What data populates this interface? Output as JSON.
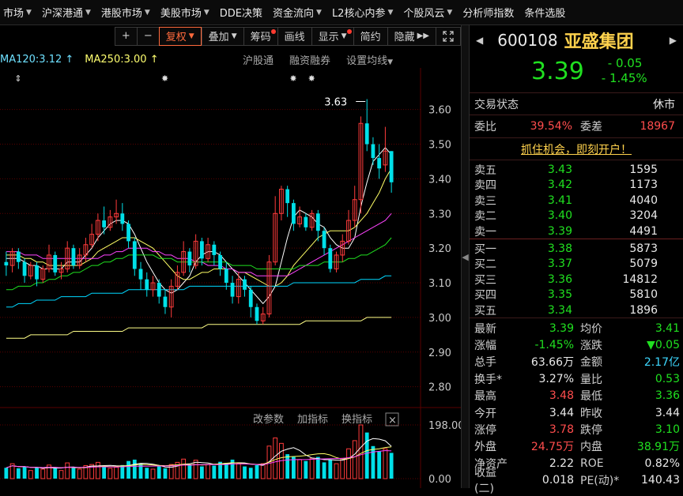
{
  "menu": [
    "市场",
    "沪深港通",
    "港股市场",
    "美股市场",
    "DDE决策",
    "资金流向",
    "L2核心内参",
    "个股风云",
    "分析师指数",
    "条件选股"
  ],
  "menu_arrows": [
    true,
    true,
    true,
    true,
    false,
    true,
    true,
    true,
    false,
    false
  ],
  "toolbar": {
    "plus": "+",
    "minus": "−",
    "fuquan": "复权",
    "diejia": "叠加",
    "chouma": "筹码",
    "huaxian": "画线",
    "xianshi": "显示",
    "jianyue": "简约",
    "yincang": "隐藏",
    "expand_icon": "double-chevron-right",
    "fullscreen_icon": "expand-arrows"
  },
  "ma_legend": {
    "ma120": "MA120:3.12",
    "ma250": "MA250:3.00",
    "arrow": "↑"
  },
  "chart_links": {
    "hugutong": "沪股通",
    "rongzi": "融资融券",
    "shezhi": "设置均线"
  },
  "indicator_links": {
    "gaicanshu": "改参数",
    "jiazhibiao": "加指标",
    "huanzhibiao": "换指标",
    "close": "×"
  },
  "colors": {
    "up": "#ff3b3b",
    "down": "#00e0e8",
    "ma5": "#ffffff",
    "ma10": "#ffff66",
    "ma20": "#ff44ff",
    "ma60": "#20e020",
    "ma120": "#00d8ff",
    "ma250": "#ffff88",
    "grid": "#5a0000"
  },
  "chart_data": {
    "type": "candlestick",
    "y_ticks": [
      "3.60",
      "3.50",
      "3.40",
      "3.30",
      "3.20",
      "3.10",
      "3.00",
      "2.90",
      "2.80"
    ],
    "ylim": [
      2.74,
      3.72
    ],
    "high_label": "3.63",
    "volume_ticks": [
      "198.00",
      "0.00"
    ],
    "volume_max": 198,
    "candles": [
      [
        3.16,
        3.15,
        3.19,
        3.12
      ],
      [
        3.15,
        3.19,
        3.2,
        3.13
      ],
      [
        3.19,
        3.16,
        3.2,
        3.14
      ],
      [
        3.16,
        3.12,
        3.17,
        3.1
      ],
      [
        3.12,
        3.15,
        3.16,
        3.11
      ],
      [
        3.15,
        3.11,
        3.16,
        3.09
      ],
      [
        3.11,
        3.14,
        3.15,
        3.1
      ],
      [
        3.14,
        3.18,
        3.21,
        3.13
      ],
      [
        3.18,
        3.13,
        3.19,
        3.12
      ],
      [
        3.13,
        3.14,
        3.16,
        3.11
      ],
      [
        3.14,
        3.2,
        3.22,
        3.13
      ],
      [
        3.2,
        3.15,
        3.21,
        3.14
      ],
      [
        3.15,
        3.18,
        3.2,
        3.14
      ],
      [
        3.18,
        3.21,
        3.23,
        3.16
      ],
      [
        3.21,
        3.24,
        3.27,
        3.2
      ],
      [
        3.24,
        3.28,
        3.3,
        3.22
      ],
      [
        3.28,
        3.26,
        3.32,
        3.24
      ],
      [
        3.26,
        3.29,
        3.31,
        3.25
      ],
      [
        3.29,
        3.3,
        3.34,
        3.27
      ],
      [
        3.3,
        3.27,
        3.33,
        3.25
      ],
      [
        3.27,
        3.22,
        3.28,
        3.2
      ],
      [
        3.22,
        3.14,
        3.23,
        3.12
      ],
      [
        3.14,
        3.11,
        3.16,
        3.08
      ],
      [
        3.11,
        3.08,
        3.13,
        3.06
      ],
      [
        3.08,
        3.1,
        3.12,
        3.06
      ],
      [
        3.1,
        3.06,
        3.11,
        3.04
      ],
      [
        3.06,
        3.03,
        3.08,
        3.01
      ],
      [
        3.03,
        3.09,
        3.11,
        3.0
      ],
      [
        3.09,
        3.13,
        3.15,
        3.08
      ],
      [
        3.13,
        3.19,
        3.22,
        3.12
      ],
      [
        3.19,
        3.15,
        3.2,
        3.13
      ],
      [
        3.15,
        3.22,
        3.24,
        3.14
      ],
      [
        3.22,
        3.17,
        3.23,
        3.15
      ],
      [
        3.17,
        3.21,
        3.23,
        3.16
      ],
      [
        3.21,
        3.18,
        3.22,
        3.15
      ],
      [
        3.18,
        3.14,
        3.19,
        3.12
      ],
      [
        3.14,
        3.1,
        3.16,
        3.08
      ],
      [
        3.1,
        3.06,
        3.12,
        3.04
      ],
      [
        3.06,
        3.11,
        3.13,
        3.04
      ],
      [
        3.11,
        3.08,
        3.12,
        3.06
      ],
      [
        3.08,
        3.03,
        3.09,
        3.0
      ],
      [
        3.03,
        2.99,
        3.04,
        2.98
      ],
      [
        2.99,
        3.01,
        3.03,
        2.98
      ],
      [
        3.01,
        3.16,
        3.18,
        3.0
      ],
      [
        3.16,
        3.3,
        3.35,
        3.15
      ],
      [
        3.3,
        3.37,
        3.38,
        3.28
      ],
      [
        3.37,
        3.33,
        3.38,
        3.29
      ],
      [
        3.33,
        3.27,
        3.34,
        3.25
      ],
      [
        3.27,
        3.29,
        3.32,
        3.26
      ],
      [
        3.29,
        3.26,
        3.3,
        3.25
      ],
      [
        3.26,
        3.3,
        3.31,
        3.25
      ],
      [
        3.3,
        3.25,
        3.31,
        3.22
      ],
      [
        3.25,
        3.2,
        3.26,
        3.18
      ],
      [
        3.2,
        3.14,
        3.21,
        3.13
      ],
      [
        3.14,
        3.18,
        3.19,
        3.13
      ],
      [
        3.18,
        3.22,
        3.24,
        3.16
      ],
      [
        3.22,
        3.28,
        3.31,
        3.21
      ],
      [
        3.28,
        3.34,
        3.38,
        3.26
      ],
      [
        3.34,
        3.56,
        3.58,
        3.3
      ],
      [
        3.56,
        3.5,
        3.63,
        3.48
      ],
      [
        3.5,
        3.46,
        3.52,
        3.44
      ],
      [
        3.46,
        3.43,
        3.5,
        3.4
      ],
      [
        3.44,
        3.48,
        3.55,
        3.42
      ],
      [
        3.48,
        3.39,
        3.48,
        3.36
      ]
    ],
    "volumes": [
      40,
      55,
      38,
      45,
      30,
      42,
      35,
      50,
      38,
      30,
      58,
      40,
      35,
      48,
      52,
      60,
      45,
      38,
      42,
      50,
      65,
      70,
      55,
      40,
      35,
      45,
      38,
      52,
      60,
      72,
      50,
      68,
      45,
      52,
      48,
      62,
      58,
      70,
      55,
      45,
      40,
      50,
      55,
      120,
      150,
      130,
      90,
      80,
      70,
      65,
      75,
      80,
      60,
      70,
      55,
      75,
      110,
      140,
      198,
      170,
      120,
      100,
      110,
      95
    ],
    "ma_series": {
      "ma5": [
        3.17,
        3.17,
        3.17,
        3.16,
        3.15,
        3.15,
        3.14,
        3.14,
        3.14,
        3.14,
        3.16,
        3.16,
        3.16,
        3.18,
        3.2,
        3.23,
        3.25,
        3.27,
        3.28,
        3.28,
        3.27,
        3.24,
        3.2,
        3.16,
        3.13,
        3.1,
        3.08,
        3.07,
        3.08,
        3.1,
        3.12,
        3.16,
        3.18,
        3.19,
        3.19,
        3.18,
        3.16,
        3.14,
        3.12,
        3.1,
        3.08,
        3.06,
        3.04,
        3.06,
        3.09,
        3.16,
        3.23,
        3.29,
        3.31,
        3.3,
        3.29,
        3.27,
        3.26,
        3.23,
        3.21,
        3.2,
        3.2,
        3.23,
        3.32,
        3.39,
        3.45,
        3.47,
        3.49,
        3.47
      ],
      "ma10": [
        3.18,
        3.18,
        3.18,
        3.17,
        3.17,
        3.16,
        3.16,
        3.15,
        3.15,
        3.15,
        3.15,
        3.15,
        3.15,
        3.16,
        3.17,
        3.19,
        3.2,
        3.21,
        3.22,
        3.23,
        3.23,
        3.23,
        3.22,
        3.21,
        3.2,
        3.18,
        3.16,
        3.14,
        3.12,
        3.11,
        3.11,
        3.12,
        3.13,
        3.13,
        3.14,
        3.14,
        3.14,
        3.14,
        3.13,
        3.13,
        3.12,
        3.11,
        3.1,
        3.09,
        3.09,
        3.1,
        3.12,
        3.15,
        3.17,
        3.19,
        3.21,
        3.23,
        3.24,
        3.25,
        3.25,
        3.25,
        3.25,
        3.26,
        3.28,
        3.3,
        3.33,
        3.36,
        3.4,
        3.43
      ],
      "ma20": [
        3.19,
        3.19,
        3.19,
        3.18,
        3.18,
        3.18,
        3.17,
        3.17,
        3.17,
        3.17,
        3.17,
        3.17,
        3.17,
        3.17,
        3.17,
        3.17,
        3.18,
        3.18,
        3.19,
        3.19,
        3.2,
        3.2,
        3.2,
        3.2,
        3.19,
        3.19,
        3.18,
        3.18,
        3.17,
        3.17,
        3.17,
        3.16,
        3.16,
        3.15,
        3.15,
        3.15,
        3.14,
        3.14,
        3.13,
        3.13,
        3.13,
        3.12,
        3.12,
        3.12,
        3.12,
        3.12,
        3.12,
        3.13,
        3.14,
        3.15,
        3.16,
        3.17,
        3.18,
        3.19,
        3.2,
        3.21,
        3.22,
        3.23,
        3.24,
        3.25,
        3.26,
        3.27,
        3.28,
        3.3
      ],
      "ma60": [
        3.08,
        3.08,
        3.09,
        3.09,
        3.09,
        3.1,
        3.1,
        3.11,
        3.11,
        3.12,
        3.12,
        3.13,
        3.13,
        3.14,
        3.15,
        3.15,
        3.16,
        3.16,
        3.17,
        3.17,
        3.18,
        3.18,
        3.18,
        3.18,
        3.18,
        3.17,
        3.17,
        3.17,
        3.16,
        3.16,
        3.16,
        3.16,
        3.16,
        3.16,
        3.16,
        3.16,
        3.16,
        3.15,
        3.15,
        3.15,
        3.15,
        3.14,
        3.14,
        3.14,
        3.14,
        3.14,
        3.14,
        3.14,
        3.15,
        3.15,
        3.15,
        3.15,
        3.16,
        3.16,
        3.16,
        3.16,
        3.17,
        3.17,
        3.18,
        3.18,
        3.19,
        3.2,
        3.21,
        3.23
      ],
      "ma120": [
        3.03,
        3.03,
        3.04,
        3.04,
        3.04,
        3.05,
        3.05,
        3.05,
        3.05,
        3.06,
        3.06,
        3.06,
        3.06,
        3.06,
        3.07,
        3.07,
        3.07,
        3.07,
        3.07,
        3.07,
        3.08,
        3.08,
        3.08,
        3.08,
        3.08,
        3.08,
        3.08,
        3.08,
        3.08,
        3.08,
        3.09,
        3.09,
        3.09,
        3.09,
        3.09,
        3.09,
        3.09,
        3.09,
        3.09,
        3.09,
        3.09,
        3.09,
        3.09,
        3.09,
        3.09,
        3.09,
        3.09,
        3.1,
        3.1,
        3.1,
        3.1,
        3.1,
        3.1,
        3.1,
        3.1,
        3.1,
        3.1,
        3.1,
        3.11,
        3.11,
        3.11,
        3.11,
        3.12,
        3.12
      ],
      "ma250": [
        2.94,
        2.94,
        2.94,
        2.94,
        2.95,
        2.95,
        2.95,
        2.95,
        2.95,
        2.95,
        2.95,
        2.96,
        2.96,
        2.96,
        2.96,
        2.96,
        2.96,
        2.96,
        2.96,
        2.96,
        2.97,
        2.97,
        2.97,
        2.97,
        2.97,
        2.97,
        2.97,
        2.97,
        2.97,
        2.97,
        2.97,
        2.97,
        2.97,
        2.98,
        2.98,
        2.98,
        2.98,
        2.98,
        2.98,
        2.98,
        2.98,
        2.98,
        2.98,
        2.98,
        2.98,
        2.98,
        2.98,
        2.98,
        2.98,
        2.99,
        2.99,
        2.99,
        2.99,
        2.99,
        2.99,
        2.99,
        2.99,
        2.99,
        2.99,
        3.0,
        3.0,
        3.0,
        3.0,
        3.0
      ]
    }
  },
  "stock": {
    "code": "600108",
    "name": "亚盛集团",
    "price": "3.39",
    "change": "- 0.05",
    "change_pct": "- 1.45%"
  },
  "status": {
    "label": "交易状态",
    "value": "休市"
  },
  "weibi": {
    "label1": "委比",
    "value1": "39.54%",
    "label2": "委差",
    "value2": "18967"
  },
  "promo": "抓住机会，即刻开户！",
  "asks": [
    {
      "name": "卖五",
      "price": "3.43",
      "vol": "1595"
    },
    {
      "name": "卖四",
      "price": "3.42",
      "vol": "1173"
    },
    {
      "name": "卖三",
      "price": "3.41",
      "vol": "4040"
    },
    {
      "name": "卖二",
      "price": "3.40",
      "vol": "3204"
    },
    {
      "name": "卖一",
      "price": "3.39",
      "vol": "4491"
    }
  ],
  "bids": [
    {
      "name": "买一",
      "price": "3.38",
      "vol": "5873"
    },
    {
      "name": "买二",
      "price": "3.37",
      "vol": "5079"
    },
    {
      "name": "买三",
      "price": "3.36",
      "vol": "14812"
    },
    {
      "name": "买四",
      "price": "3.35",
      "vol": "5810"
    },
    {
      "name": "买五",
      "price": "3.34",
      "vol": "1896"
    }
  ],
  "stats": [
    {
      "l1": "最新",
      "v1": "3.39",
      "c1": "green",
      "l2": "均价",
      "v2": "3.41",
      "c2": "green"
    },
    {
      "l1": "涨幅",
      "v1": "-1.45%",
      "c1": "green",
      "l2": "涨跌",
      "v2": "▼0.05",
      "c2": "green"
    },
    {
      "l1": "总手",
      "v1": "63.66万",
      "c1": "white",
      "l2": "金额",
      "v2": "2.17亿",
      "c2": "cyan"
    },
    {
      "l1": "换手*",
      "v1": "3.27%",
      "c1": "white",
      "l2": "量比",
      "v2": "0.53",
      "c2": "green"
    },
    {
      "l1": "最高",
      "v1": "3.48",
      "c1": "red",
      "l2": "最低",
      "v2": "3.36",
      "c2": "green"
    },
    {
      "l1": "今开",
      "v1": "3.44",
      "c1": "white",
      "l2": "昨收",
      "v2": "3.44",
      "c2": "white"
    },
    {
      "l1": "涨停",
      "v1": "3.78",
      "c1": "red",
      "l2": "跌停",
      "v2": "3.10",
      "c2": "green"
    },
    {
      "l1": "外盘",
      "v1": "24.75万",
      "c1": "red",
      "l2": "内盘",
      "v2": "38.91万",
      "c2": "green"
    },
    {
      "l1": "净资产",
      "v1": "2.22",
      "c1": "white",
      "l2": "ROE",
      "v2": "0.82%",
      "c2": "white"
    },
    {
      "l1": "收益(二)",
      "v1": "0.018",
      "c1": "white",
      "l2": "PE(动)*",
      "v2": "140.43",
      "c2": "white"
    }
  ]
}
